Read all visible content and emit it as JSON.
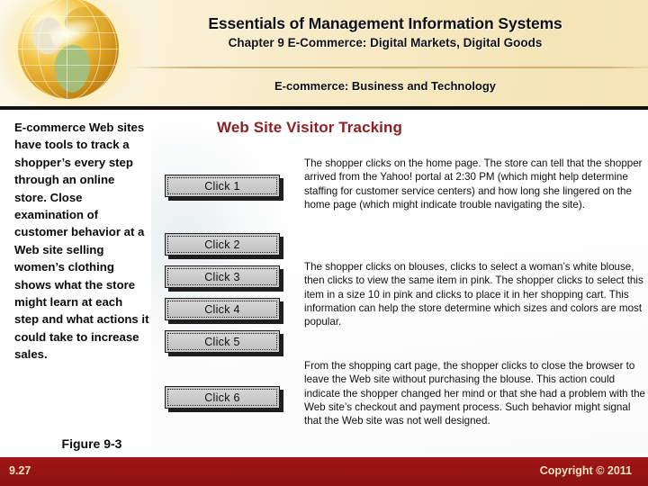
{
  "header": {
    "title": "Essentials of Management Information Systems",
    "subtitle": "Chapter 9 E-Commerce: Digital Markets, Digital Goods",
    "section": "E-commerce: Business and Technology",
    "logo_name": "globe-logo"
  },
  "left_column": {
    "body": "E-commerce Web sites have tools to track a shopper’s every step through an online store. Close examination of customer behavior at a Web site selling women’s clothing shows what the store might learn at each step and what actions it could take to increase sales.",
    "figure_caption": "Figure 9-3"
  },
  "figure": {
    "title": "Web Site Visitor Tracking",
    "steps": [
      {
        "label": "Click 1"
      },
      {
        "label": "Click 2"
      },
      {
        "label": "Click 3"
      },
      {
        "label": "Click 4"
      },
      {
        "label": "Click 5"
      },
      {
        "label": "Click 6"
      }
    ],
    "descriptions": [
      "The shopper clicks on the home page. The store can tell that the shopper arrived from the Yahoo! portal at 2:30 PM (which might help determine staffing for customer service centers) and how long she lingered on the home page (which might indicate trouble navigating the site).",
      "The shopper clicks on blouses, clicks to select a woman’s white blouse, then clicks to view the same item in pink. The shopper clicks to select this item in a size 10 in pink and clicks to place it in her shopping cart. This information can help the store determine which sizes and colors are most popular.",
      "From the shopping cart page, the shopper clicks to close the browser to leave the Web site without purchasing the blouse. This action could indicate the shopper changed her mind or that she had a problem with the Web site’s checkout and payment process. Such behavior might signal that the Web site was not well designed."
    ]
  },
  "footer": {
    "slide_number": "9.27",
    "copyright": "Copyright © 2011"
  },
  "colors": {
    "header_cream": "#f6e7bd",
    "footer_red": "#981414",
    "figure_title_red": "#8f1f23",
    "footer_text": "#f3e3c2"
  }
}
